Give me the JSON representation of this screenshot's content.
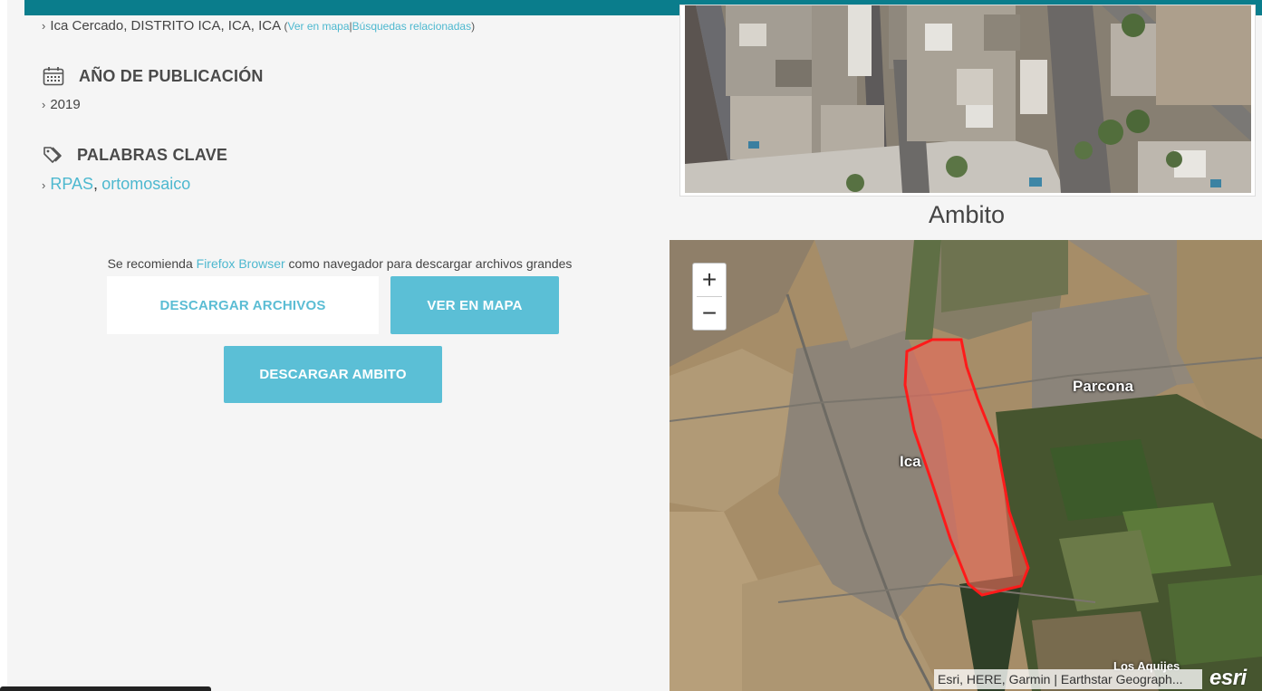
{
  "location": {
    "text": "Ica Cercado, DISTRITO ICA, ICA, ICA",
    "paren_open": "(",
    "map_link": "Ver en mapa",
    "separator": "|",
    "related_link": "Búsquedas relacionadas",
    "paren_close": ")"
  },
  "publication": {
    "heading": "AÑO DE PUBLICACIÓN",
    "year": "2019"
  },
  "keywords": {
    "heading": "PALABRAS CLAVE",
    "items": [
      "RPAS",
      "ortomosaico"
    ],
    "separator": ","
  },
  "recommendation": {
    "prefix": "Se recomienda ",
    "browser_link": "Firefox Browser",
    "suffix": " como navegador para descargar archivos grandes"
  },
  "buttons": {
    "download_files": "DESCARGAR ARCHIVOS",
    "view_map": "VER EN MAPA",
    "download_scope": "DESCARGAR AMBITO"
  },
  "ambito": {
    "title": "Ambito"
  },
  "map": {
    "zoom_in": "+",
    "zoom_out": "−",
    "labels": {
      "ica": "Ica",
      "parcona": "Parcona",
      "los_aquijes": "Los Aquijes"
    },
    "attribution": "Esri, HERE, Garmin | Earthstar Geograph...",
    "logo": "esri",
    "polygon_fill": "#e86a5a",
    "polygon_stroke": "#ff1a1a"
  },
  "colors": {
    "accent": "#5bbfd6",
    "link": "#4db8cf",
    "top_bar": "#0a7d8c"
  },
  "icons": {
    "chevron": "›",
    "calendar": "calendar-icon",
    "tags": "tags-icon"
  }
}
